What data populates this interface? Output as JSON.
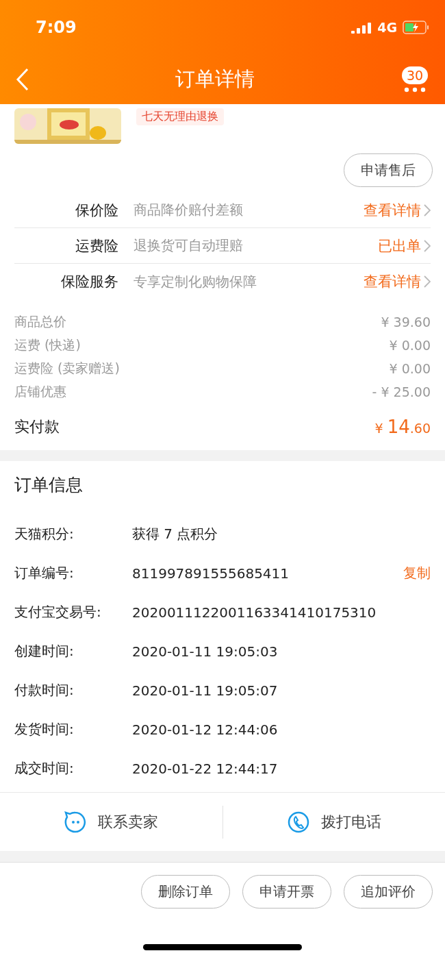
{
  "status_bar": {
    "time": "7:09",
    "network": "4G"
  },
  "header": {
    "title": "订单详情",
    "badge": "30"
  },
  "product": {
    "tag": "七天无理由退换"
  },
  "after_sale_button": "申请售后",
  "insurance": [
    {
      "name": "保价险",
      "desc": "商品降价赔付差额",
      "action": "查看详情"
    },
    {
      "name": "运费险",
      "desc": "退换货可自动理赔",
      "action": "已出单"
    },
    {
      "name": "保险服务",
      "desc": "专享定制化购物保障",
      "action": "查看详情"
    }
  ],
  "prices": [
    {
      "label": "商品总价",
      "value": "¥ 39.60"
    },
    {
      "label": "运费 (快递)",
      "value": "¥ 0.00"
    },
    {
      "label": "运费险 (卖家赠送)",
      "value": "¥ 0.00"
    },
    {
      "label": "店铺优惠",
      "value": "- ¥ 25.00"
    }
  ],
  "paid": {
    "label": "实付款",
    "currency": "¥",
    "integer": "14",
    "decimal": ".60"
  },
  "order_info": {
    "title": "订单信息",
    "rows": [
      {
        "label": "天猫积分:",
        "value": "获得 7 点积分"
      },
      {
        "label": "订单编号:",
        "value": "811997891555685411",
        "action": "复制"
      },
      {
        "label": "支付宝交易号:",
        "value": "2020011122001163341410175310"
      },
      {
        "label": "创建时间:",
        "value": "2020-01-11 19:05:03"
      },
      {
        "label": "付款时间:",
        "value": "2020-01-11 19:05:07"
      },
      {
        "label": "发货时间:",
        "value": "2020-01-12 12:44:06"
      },
      {
        "label": "成交时间:",
        "value": "2020-01-22 12:44:17"
      }
    ]
  },
  "contact": [
    {
      "kind": "chat",
      "label": "联系卖家"
    },
    {
      "kind": "phone",
      "label": "拨打电话"
    }
  ],
  "bottom_buttons": [
    "删除订单",
    "申请开票",
    "追加评价"
  ]
}
